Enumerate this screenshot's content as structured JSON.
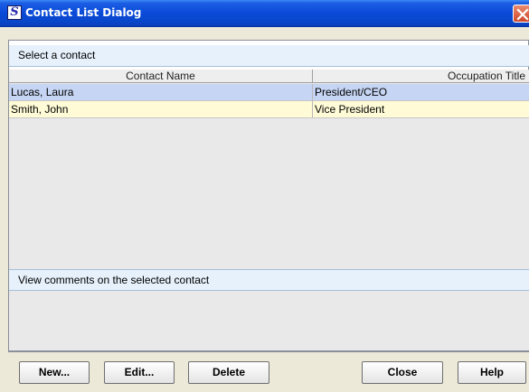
{
  "window": {
    "title": "Contact List Dialog"
  },
  "contacts_section": {
    "header": "Select a contact"
  },
  "table": {
    "columns": [
      "Contact Name",
      "Occupation Title"
    ],
    "rows": [
      {
        "name": "Lucas, Laura",
        "title": "President/CEO",
        "selected": true
      },
      {
        "name": "Smith, John",
        "title": "Vice President",
        "selected": false
      }
    ]
  },
  "comments_section": {
    "header": "View comments on the selected contact"
  },
  "buttons": {
    "new": "New...",
    "edit": "Edit...",
    "delete": "Delete",
    "close": "Close",
    "help": "Help"
  },
  "colors": {
    "titlebar": "#0a4ad8",
    "selected_row": "#c6d5f3",
    "alt_row": "#fefbd6",
    "section_header": "#e6f1fb"
  }
}
